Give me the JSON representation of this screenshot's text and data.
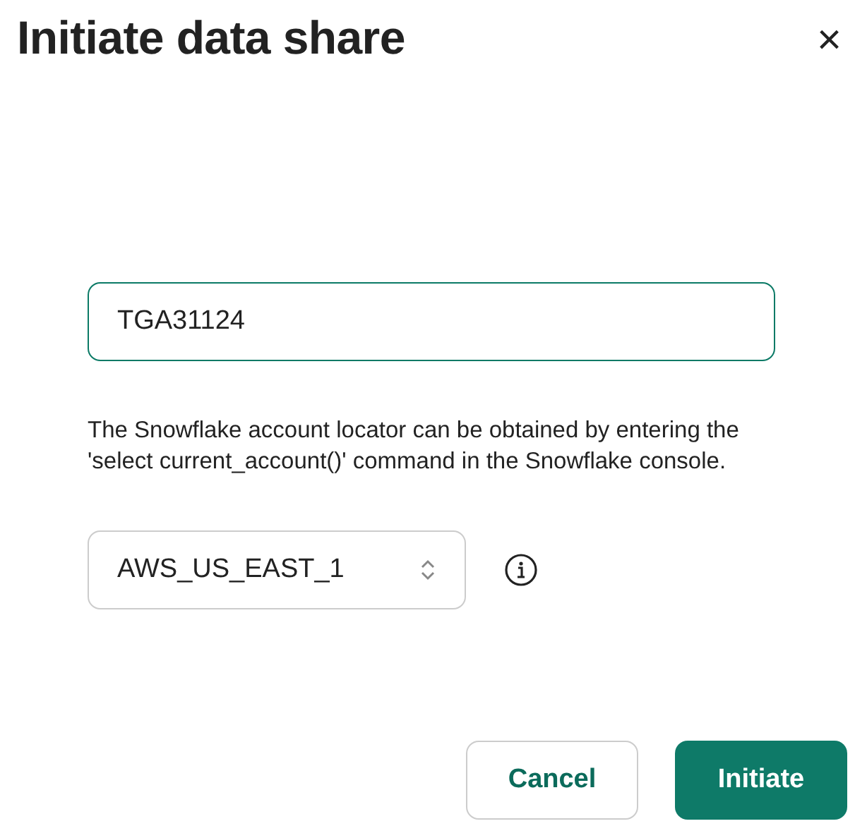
{
  "dialog": {
    "title": "Initiate data share",
    "close": "×"
  },
  "account_field": {
    "value": "TGA31124",
    "focused": true
  },
  "help_text": "The Snowflake account locator can be obtained by entering the 'select current_account()' command in the Snowflake console.",
  "region_select": {
    "value": "AWS_US_EAST_1"
  },
  "buttons": [
    {
      "label": "Cancel",
      "kind": "secondary"
    },
    {
      "label": "Initiate",
      "kind": "primary"
    }
  ]
}
